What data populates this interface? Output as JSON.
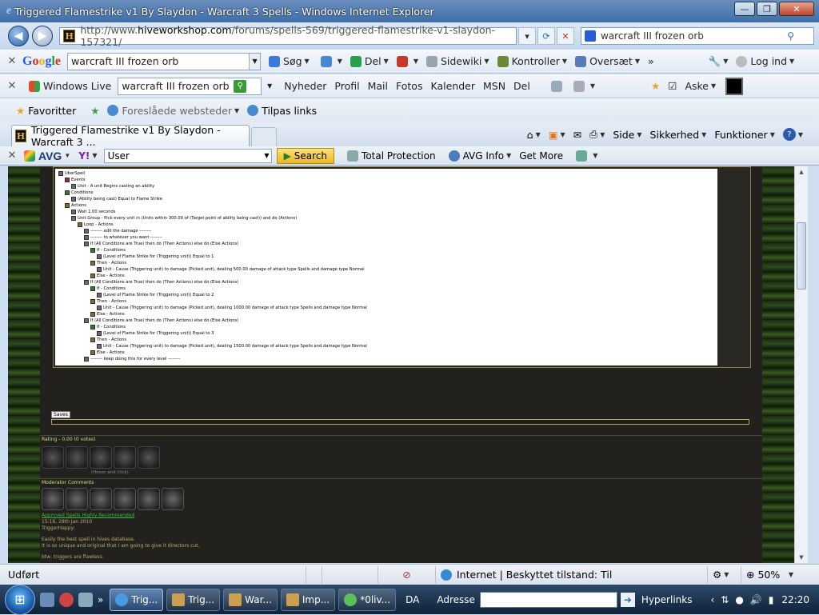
{
  "window": {
    "title": "Triggered Flamestrike v1 By Slaydon - Warcraft 3 Spells - Windows Internet Explorer"
  },
  "address": {
    "prefix": "http://www.",
    "host": "hiveworkshop.com",
    "path": "/forums/spells-569/triggered-flamestrike-v1-slaydon-157321/",
    "search_value": "warcraft III frozen orb"
  },
  "google_bar": {
    "logo": "Google",
    "search_value": "warcraft III frozen orb",
    "items": [
      "Søg",
      "Del",
      "Sidewiki",
      "Kontroller",
      "Oversæt",
      "Log ind"
    ]
  },
  "windows_live_bar": {
    "label": "Windows Live",
    "search_value": "warcraft III frozen orb",
    "links": [
      "Nyheder",
      "Profil",
      "Mail",
      "Fotos",
      "Kalender",
      "MSN",
      "Del"
    ],
    "user": "Aske"
  },
  "favorites_bar": {
    "favorites_label": "Favoritter",
    "items": [
      "Foreslåede websteder",
      "Tilpas links"
    ]
  },
  "tab": {
    "title": "Triggered Flamestrike v1 By Slaydon - Warcraft 3 ..."
  },
  "command_bar": {
    "items": [
      "Side",
      "Sikkerhed",
      "Funktioner"
    ]
  },
  "avg_bar": {
    "logo": "AVG",
    "search_value": "User",
    "search_button": "Search",
    "items": [
      "Total Protection",
      "AVG Info",
      "Get More"
    ]
  },
  "trigger_lines": [
    "UberSpell",
    "Events",
    "Unit - A unit Begins casting an ability",
    "Conditions",
    "(Ability being cast) Equal to Flame Strike",
    "Actions",
    "Wait 1.00 seconds",
    "Unit Group - Pick every unit in (Units within 300.00 of (Target point of ability being cast)) and do (Actions)",
    "Loop - Actions",
    "-------- edit the damage --------",
    "-------- to whatever you want --------",
    "If (All Conditions are True) then do (Then Actions) else do (Else Actions)",
    "If - Conditions",
    "(Level of Flame Strike for (Triggering unit)) Equal to 1",
    "Then - Actions",
    "Unit - Cause (Triggering unit) to damage (Picked unit), dealing 500.00 damage of attack type Spells and damage type Normal",
    "Else - Actions",
    "If (All Conditions are True) then do (Then Actions) else do (Else Actions)",
    "If - Conditions",
    "(Level of Flame Strike for (Triggering unit)) Equal to 2",
    "Then - Actions",
    "Unit - Cause (Triggering unit) to damage (Picked unit), dealing 1000.00 damage of attack type Spells and damage type Normal",
    "Else - Actions",
    "If (All Conditions are True) then do (Then Actions) else do (Else Actions)",
    "If - Conditions",
    "(Level of Flame Strike for (Triggering unit)) Equal to 3",
    "Then - Actions",
    "Unit - Cause (Triggering unit) to damage (Picked unit), dealing 1500.00 damage of attack type Spells and damage type Normal",
    "Else - Actions",
    "-------- keep doing this for every level --------"
  ],
  "trigger_indent": [
    0,
    1,
    2,
    1,
    2,
    1,
    2,
    2,
    3,
    4,
    4,
    4,
    5,
    6,
    5,
    6,
    5,
    4,
    5,
    6,
    5,
    6,
    5,
    4,
    5,
    6,
    5,
    6,
    5,
    4
  ],
  "trigger_kind": [
    "root",
    "ev",
    "item",
    "co",
    "item",
    "ac",
    "item",
    "item",
    "ac",
    "item",
    "item",
    "item",
    "co",
    "item",
    "ac",
    "item",
    "ac",
    "item",
    "co",
    "item",
    "ac",
    "item",
    "ac",
    "item",
    "co",
    "item",
    "ac",
    "item",
    "ac",
    "item"
  ],
  "page": {
    "saved_tag": "Saves",
    "rating": "Rating - 0.00 (0 votes)",
    "hover_hint": "(Hover and click)",
    "moderator_label": "Moderator Comments",
    "recommend": "Approved Spells Highly Recommended",
    "mod_date": "15:16, 29th Jan 2010",
    "mod_name": "TriggerHappy:",
    "mod_text_1": "Easily the best spell in hives database.",
    "mod_text_2": "It is so unique and original that I am going to give it directors cut.",
    "mod_text_3": "btw, triggers are flawless."
  },
  "status": {
    "done": "Udført",
    "zone": "Internet | Beskyttet tilstand: Til",
    "zoom": "50%"
  },
  "taskbar": {
    "buttons": [
      "Trig...",
      "Trig...",
      "War...",
      "Imp...",
      "*0liv..."
    ],
    "lang": "DA",
    "address_label": "Adresse",
    "hyperlinks_label": "Hyperlinks",
    "time": "22:20"
  },
  "colors": {
    "accent": "#3f6ea8",
    "page_bg": "#23211d",
    "rating_text": "#c9e07c",
    "recommend": "#39c23a"
  }
}
